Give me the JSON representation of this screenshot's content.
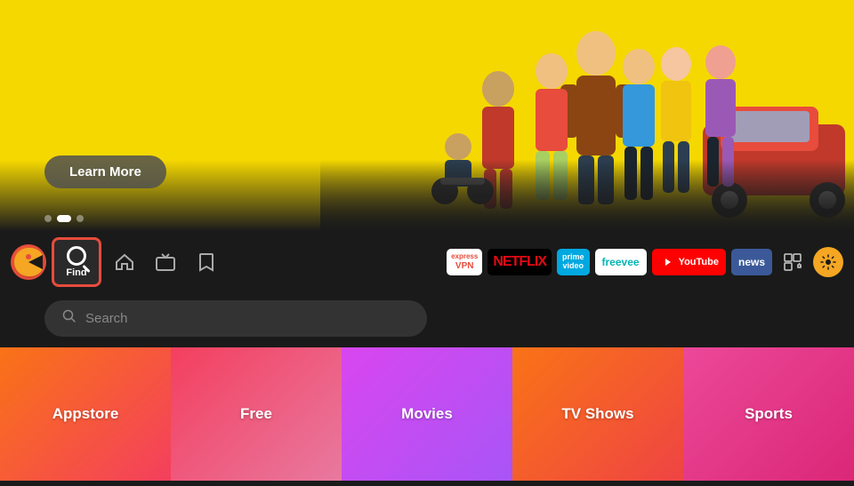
{
  "hero": {
    "background_color": "#f5d800",
    "learn_more_label": "Learn More",
    "dots": [
      {
        "active": false
      },
      {
        "active": true
      },
      {
        "active": false
      }
    ]
  },
  "nav": {
    "find_label": "Find",
    "search_placeholder": "Search",
    "channels": [
      {
        "id": "expressvpn",
        "label": "ExpressVPN"
      },
      {
        "id": "netflix",
        "label": "NETFLIX"
      },
      {
        "id": "prime",
        "label": "prime video"
      },
      {
        "id": "freevee",
        "label": "freevee"
      },
      {
        "id": "youtube",
        "label": "YouTube"
      },
      {
        "id": "news",
        "label": "news"
      }
    ]
  },
  "categories": [
    {
      "id": "appstore",
      "label": "Appstore"
    },
    {
      "id": "free",
      "label": "Free"
    },
    {
      "id": "movies",
      "label": "Movies"
    },
    {
      "id": "tvshows",
      "label": "TV Shows"
    },
    {
      "id": "sports",
      "label": "Sports"
    }
  ]
}
